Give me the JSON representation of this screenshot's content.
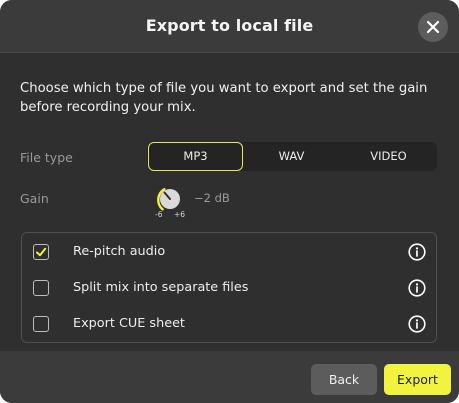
{
  "dialog": {
    "title": "Export to local file",
    "close_icon": "close-icon"
  },
  "intro": {
    "text": "Choose which type of file you want to export and set the gain before recording your mix."
  },
  "file_type": {
    "label": "File type",
    "options": [
      "MP3",
      "WAV",
      "VIDEO"
    ],
    "selected": "MP3"
  },
  "gain": {
    "label": "Gain",
    "min_label": "-6",
    "max_label": "+6",
    "value_text": "−2 dB",
    "value_db": -2
  },
  "options": [
    {
      "label": "Re-pitch audio",
      "checked": true,
      "info_icon": "info-icon"
    },
    {
      "label": "Split mix into separate files",
      "checked": false,
      "info_icon": "info-icon"
    },
    {
      "label": "Export CUE sheet",
      "checked": false,
      "info_icon": "info-icon"
    }
  ],
  "footer": {
    "back_label": "Back",
    "export_label": "Export"
  },
  "colors": {
    "accent": "#f2f33f",
    "dialog_bg": "#3b3b3b",
    "body_bg": "#2f2f2f"
  }
}
